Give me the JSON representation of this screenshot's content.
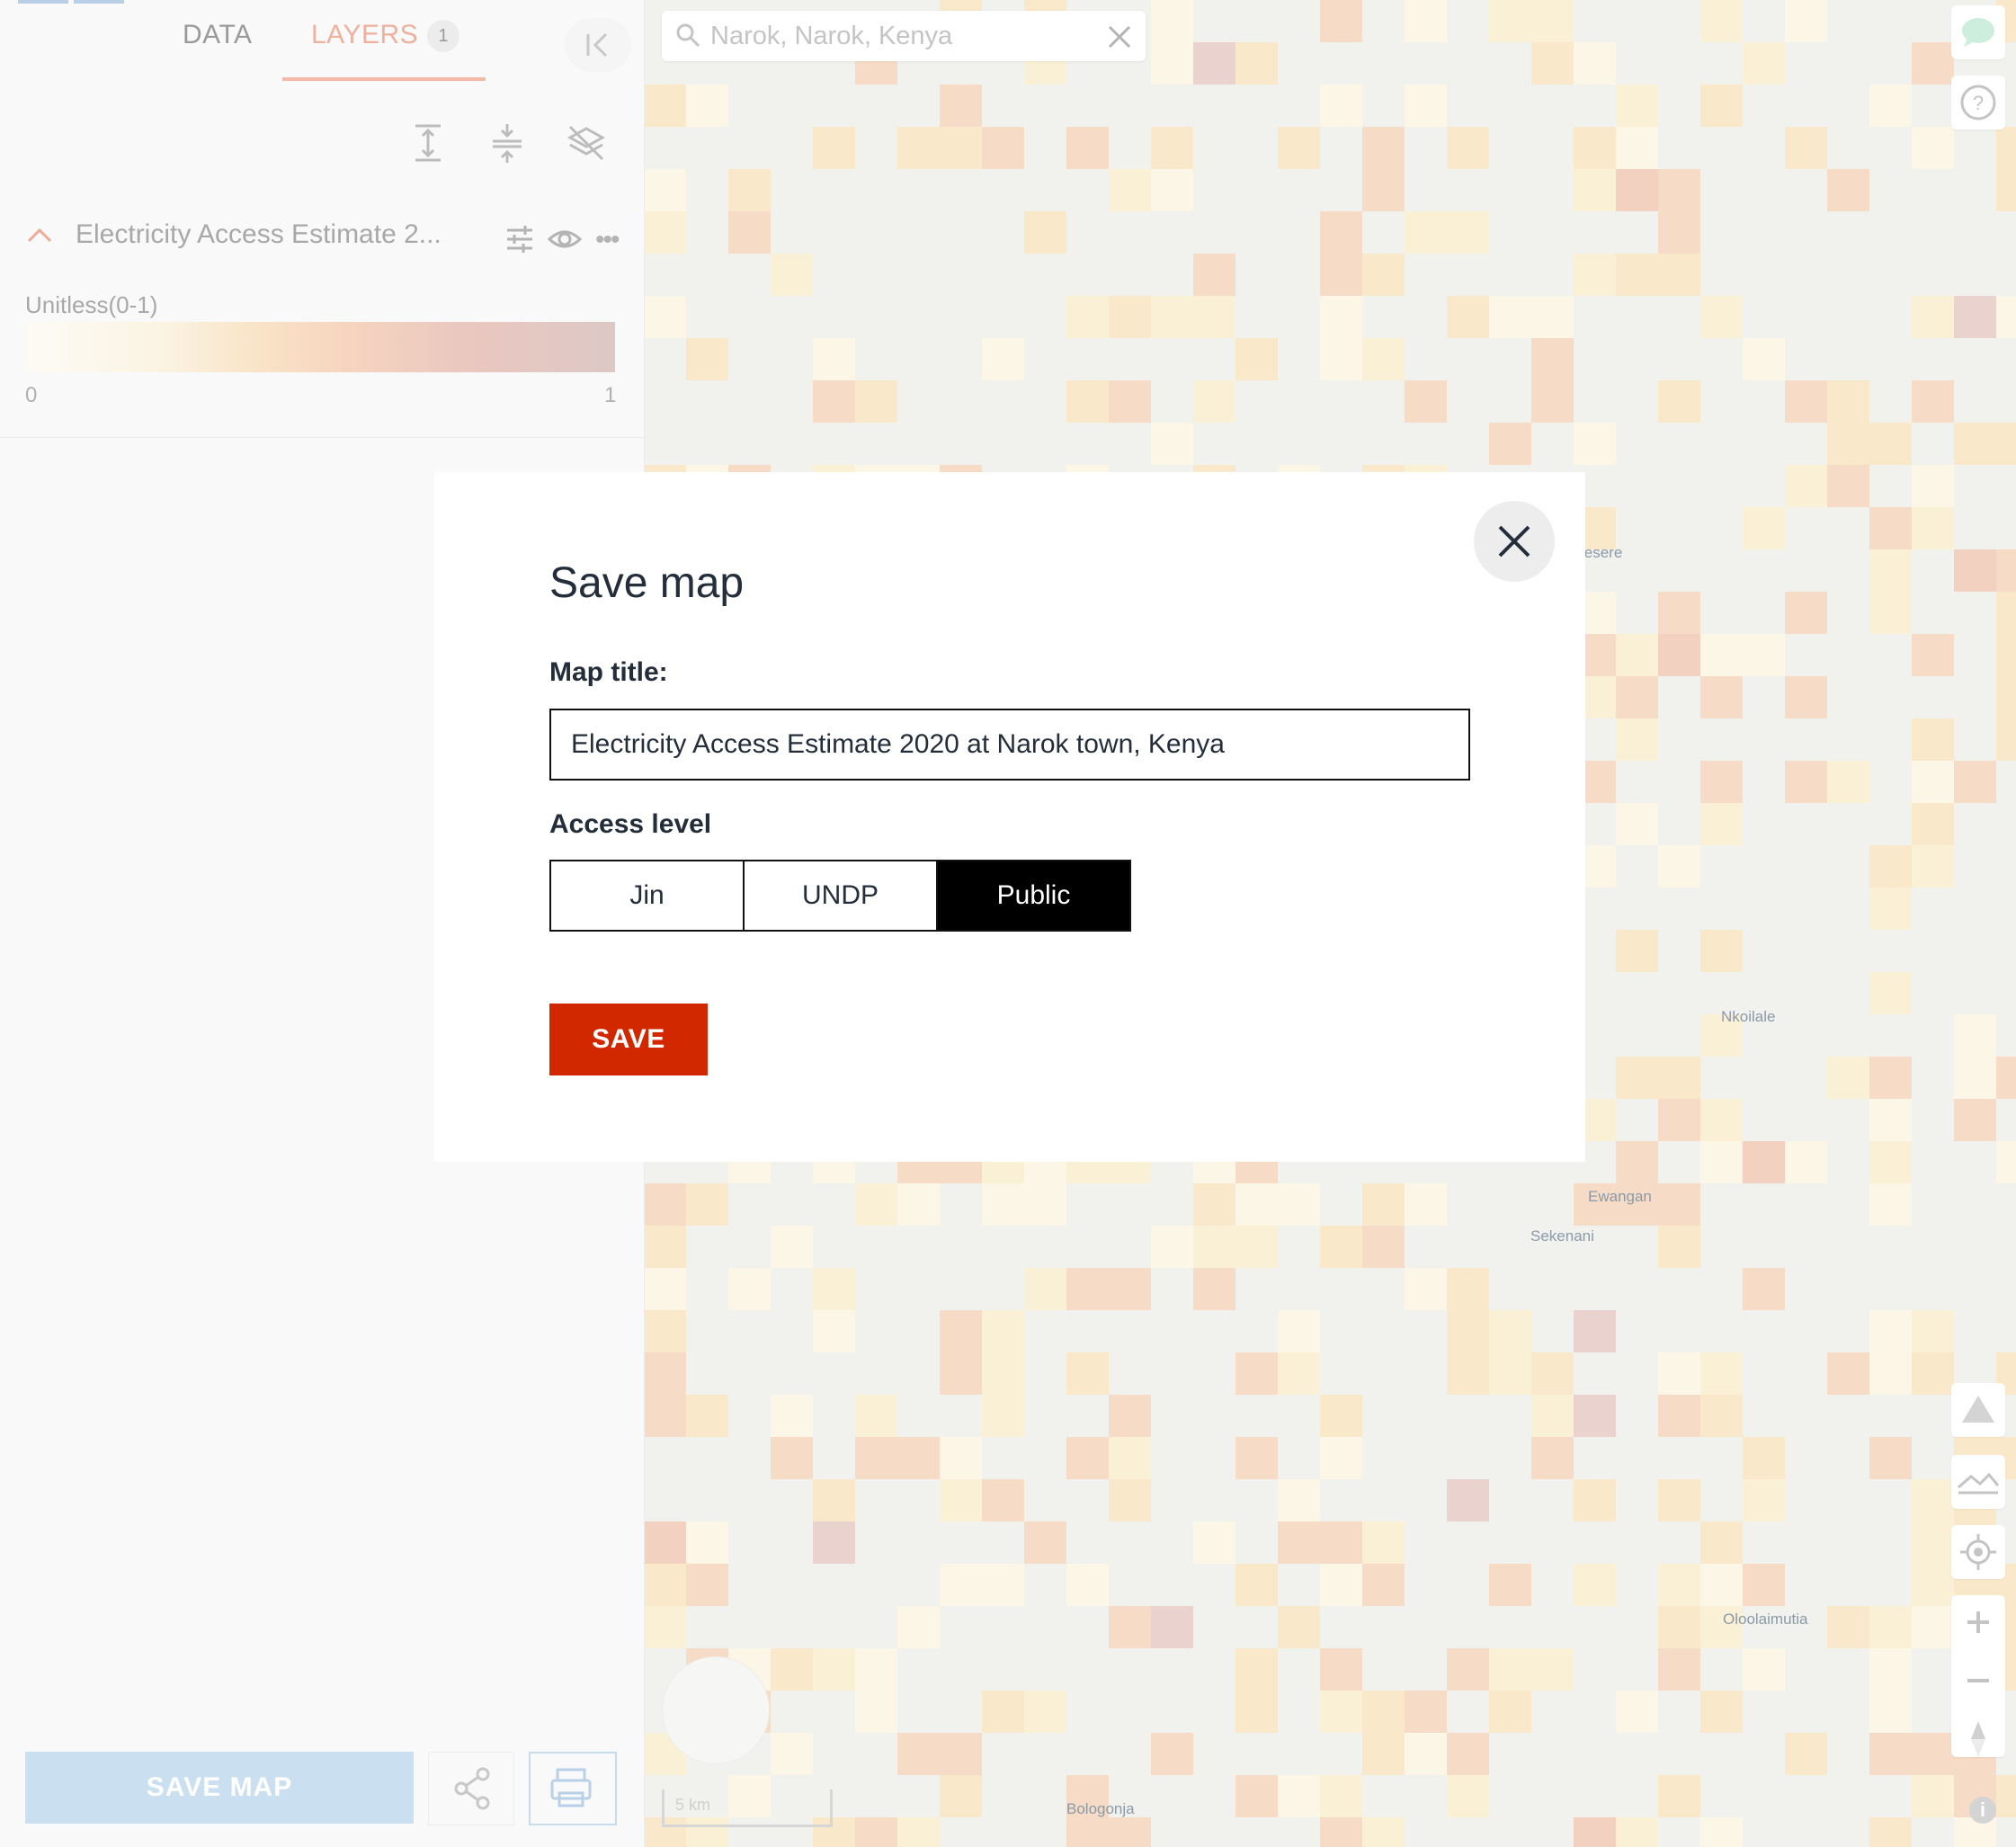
{
  "panel": {
    "tabs": {
      "data": "DATA",
      "layers": "LAYERS",
      "layers_count": "1"
    },
    "layer": {
      "name": "Electricity Access Estimate 2...",
      "unit": "Unitless(0-1)",
      "legend_min": "0",
      "legend_max": "1"
    },
    "footer": {
      "save_map": "SAVE MAP"
    }
  },
  "search": {
    "value": "Narok, Narok, Kenya"
  },
  "map": {
    "places": {
      "olesere": "lesere",
      "nkoilale": "Nkoilale",
      "ewangan": "Ewangan",
      "sekenani": "Sekenani",
      "oloolaimutia": "Oloolaimutia",
      "bologonja": "Bologonja"
    },
    "scale": "5 km"
  },
  "modal": {
    "title": "Save map",
    "map_title_label": "Map title:",
    "map_title_value": "Electricity Access Estimate 2020 at Narok town, Kenya",
    "access_label": "Access level",
    "access_options": [
      "Jin",
      "UNDP",
      "Public"
    ],
    "access_selected": "Public",
    "save": "SAVE"
  },
  "colors": {
    "accent": "#d12800",
    "legend_start": "#fdfbf5",
    "legend_end": "#ddc8c6",
    "layers_tab": "#efb09e"
  }
}
